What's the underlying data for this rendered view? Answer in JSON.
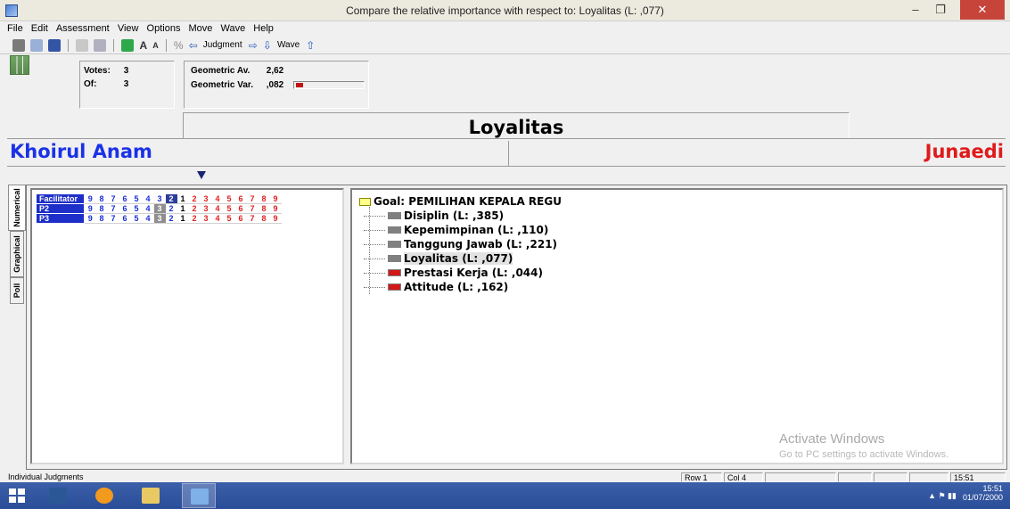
{
  "window": {
    "title": "Compare the relative importance  with respect to: Loyalitas (L: ,077)",
    "min_icon": "minimize-icon",
    "max_icon": "restore-icon",
    "close_icon": "close-icon"
  },
  "menu": [
    "File",
    "Edit",
    "Assessment",
    "View",
    "Options",
    "Move",
    "Wave",
    "Help"
  ],
  "toolbar": {
    "judgment_label": "Judgment",
    "wave_label": "Wave"
  },
  "votes": {
    "votes_label": "Votes:",
    "votes_value": "3",
    "of_label": "Of:",
    "of_value": "3"
  },
  "geometric": {
    "av_label": "Geometric Av.",
    "av_value": "2,62",
    "var_label": "Geometric Var.",
    "var_value": ",082",
    "var_fraction": 0.1
  },
  "comparison": {
    "goal": "Loyalitas",
    "left_name": "Khoirul Anam",
    "right_name": "Junaedi"
  },
  "side_tabs": [
    "Numerical",
    "Graphical",
    "Poll"
  ],
  "judgments": {
    "scale_left": [
      "9",
      "8",
      "7",
      "6",
      "5",
      "4",
      "3",
      "2"
    ],
    "scale_center": "1",
    "scale_right": [
      "2",
      "3",
      "4",
      "5",
      "6",
      "7",
      "8",
      "9"
    ],
    "rows": [
      {
        "name": "Facilitator",
        "selected": "2 (left)"
      },
      {
        "name": "P2",
        "selected": "3 (left)"
      },
      {
        "name": "P3",
        "selected": "3 (left)"
      }
    ]
  },
  "tree": {
    "goal": "Goal: PEMILIHAN KEPALA REGU",
    "nodes": [
      {
        "label": "Disiplin (L: ,385)",
        "marker": "gray"
      },
      {
        "label": "Kepemimpinan (L: ,110)",
        "marker": "gray"
      },
      {
        "label": "Tanggung Jawab (L: ,221)",
        "marker": "gray"
      },
      {
        "label": "Loyalitas (L: ,077)",
        "marker": "gray"
      },
      {
        "label": "Prestasi Kerja (L: ,044)",
        "marker": "red"
      },
      {
        "label": "Attitude (L: ,162)",
        "marker": "red"
      }
    ]
  },
  "watermark": {
    "title": "Activate Windows",
    "subtitle": "Go to PC settings to activate Windows."
  },
  "status": {
    "mode": "Individual Judgments",
    "row": "Row 1",
    "col": "Col 4",
    "time": "15:51"
  },
  "taskbar": {
    "clock_time": "15:51",
    "clock_date": "01/07/2000",
    "apps": [
      "word-icon",
      "chrome-like-icon",
      "file-explorer-icon",
      "expert-choice-icon"
    ]
  }
}
